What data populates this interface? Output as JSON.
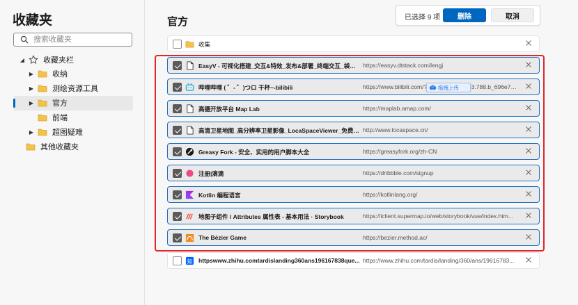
{
  "sidebar": {
    "title": "收藏夹",
    "search_placeholder": "搜索收藏夹",
    "tree": [
      {
        "label": "收藏夹栏"
      },
      {
        "label": "收纳"
      },
      {
        "label": "测绘资源工具"
      },
      {
        "label": "官方"
      },
      {
        "label": "前端"
      },
      {
        "label": "超图疑难"
      },
      {
        "label": "其他收藏夹"
      }
    ]
  },
  "main": {
    "title": "官方",
    "selection_count": "已选择 9 项",
    "delete_label": "删除",
    "cancel_label": "取消",
    "upload_label": "拖拽上传",
    "rows": [
      {
        "title": "收集",
        "url": "",
        "selected": false,
        "icon": "folder-icon"
      },
      {
        "title": "EasyV - 可视化搭建_交互&特效_发布&部署_终端交互_袋鼠云",
        "url": "https://easyv.dtstack.com/lengj",
        "selected": true,
        "icon": "page-icon"
      },
      {
        "title": "哔哩哔哩 ( ゜- ゜)つロ 干杯~-bilibili",
        "url": "https://www.bilibili.com/?spm_id_from=333.788.b_696e74...",
        "selected": true,
        "icon": "bilibili-icon"
      },
      {
        "title": "高德开放平台 Map Lab",
        "url": "https://maplab.amap.com/",
        "selected": true,
        "icon": "page-icon"
      },
      {
        "title": "高清卫星地图_高分辨率卫星影像_LocaSpaceViewer_免费地图...",
        "url": "http://www.locaspace.cn/",
        "selected": true,
        "icon": "page-icon"
      },
      {
        "title": "Greasy Fork - 安全、实用的用户脚本大全",
        "url": "https://greasyfork.org/zh-CN",
        "selected": true,
        "icon": "greasyfork-icon"
      },
      {
        "title": "注册|滴滴",
        "url": "https://dribbble.com/signup",
        "selected": true,
        "icon": "dribbble-icon"
      },
      {
        "title": "Kotlin 编程语言",
        "url": "https://kotlinlang.org/",
        "selected": true,
        "icon": "kotlin-icon"
      },
      {
        "title": "地图子组件 / Attributes 属性表 - 基本用法 · Storybook",
        "url": "https://iclient.supermap.io/web/storybook/vue/index.htm...",
        "selected": true,
        "icon": "supermap-icon"
      },
      {
        "title": "The Bézier Game",
        "url": "https://bezier.method.ac/",
        "selected": true,
        "icon": "bezier-icon"
      },
      {
        "title": "httpswww.zhihu.comtardislanding360ans196167838que...",
        "url": "https://www.zhihu.com/tardis/landing/360/ans/19616783...",
        "selected": false,
        "icon": "zhihu-icon"
      }
    ]
  },
  "colors": {
    "accent": "#0067c0",
    "highlight_border": "#e0262a",
    "selected_border": "#1f6fbf",
    "folder": "#f2c24a"
  }
}
